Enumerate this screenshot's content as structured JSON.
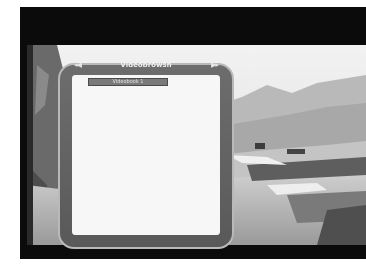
{
  "osd": {
    "title": "Videobrowsh",
    "left_arrow": "◂◀",
    "right_arrow": "▶▸",
    "items": [
      {
        "label": "Videobook 1"
      }
    ]
  },
  "colors": {
    "background": "#0b0b0b",
    "panel_frame": "#6d6d6d",
    "panel_list": "#f7f7f7",
    "selected_item": "#7a7a7a"
  }
}
